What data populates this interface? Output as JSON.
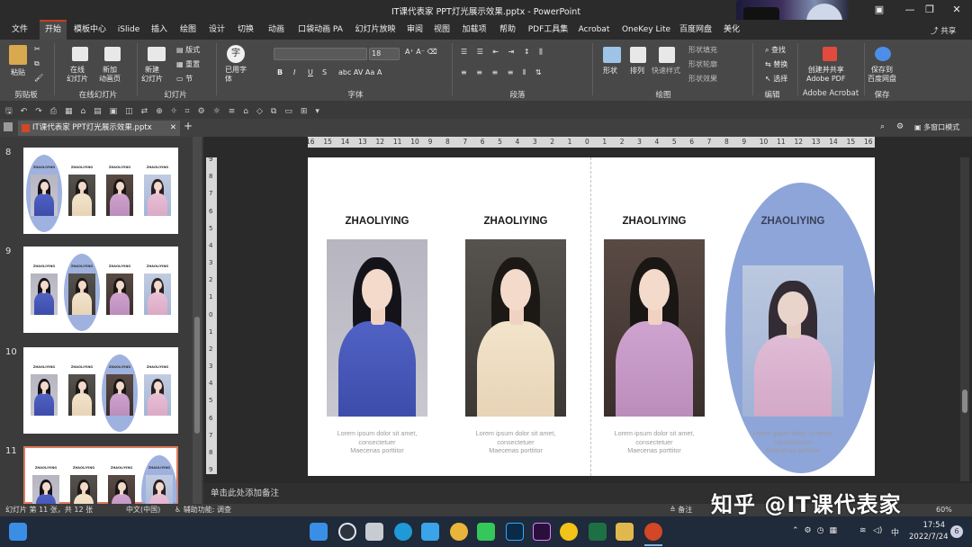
{
  "window": {
    "title": "IT课代表家 PPT灯光展示效果.pptx - PowerPoint",
    "share_label": "共享",
    "minimize_glyph": "—",
    "maximize_glyph": "❐",
    "close_glyph": "✕",
    "restore_glyph": "▣"
  },
  "ribbon_tabs": [
    "文件",
    "开始",
    "模板中心",
    "iSlide",
    "插入",
    "绘图",
    "设计",
    "切换",
    "动画",
    "口袋动画 PA",
    "幻灯片放映",
    "审阅",
    "视图",
    "加载项",
    "帮助",
    "PDF工具集",
    "Acrobat",
    "OneKey Lite",
    "百度网盘",
    "美化"
  ],
  "active_tab": "开始",
  "ribbon": {
    "clipboard": {
      "paste": "粘贴",
      "group": "剪贴板"
    },
    "online_slides": {
      "online": "在线\n幻灯片",
      "new_anim": "新加\n动画页",
      "group": "在线幻灯片"
    },
    "slides": {
      "new_slide": "新建\n幻灯片",
      "layout": "版式",
      "reset": "重置",
      "section": "节",
      "group": "幻灯片"
    },
    "font": {
      "use_font": "已用字\n体",
      "size": "18",
      "group": "字体",
      "b": "B",
      "i": "I",
      "u": "U",
      "s": "S",
      "char_glyph": "字"
    },
    "paragraph": {
      "group": "段落"
    },
    "drawing": {
      "shapes": "形状",
      "arrange": "排列",
      "quick_styles": "快速样式",
      "fill": "形状填充",
      "outline": "形状轮廓",
      "effect": "形状效果",
      "group": "绘图"
    },
    "editing": {
      "find": "查找",
      "replace": "替换",
      "select": "选择",
      "group": "编辑"
    },
    "acrobat": {
      "create": "创建并共享\nAdobe PDF",
      "group": "Adobe Acrobat"
    },
    "save": {
      "save_baidu": "保存到\n百度网盘",
      "group": "保存"
    }
  },
  "file_tab": {
    "name": "IT课代表家 PPT灯光展示效果.pptx",
    "close": "✕",
    "add": "+",
    "multi_window": "多窗口模式"
  },
  "thumbnails": [
    {
      "number": "8",
      "highlight": 0
    },
    {
      "number": "9",
      "highlight": 1
    },
    {
      "number": "10",
      "highlight": 2
    },
    {
      "number": "11",
      "highlight": 3
    }
  ],
  "slide": {
    "columns": [
      {
        "title": "ZHAOLIYING",
        "caption": "Lorem ipsum dolor sit amet,\nconsectetuer\nMaecenas porttitor",
        "photo": "blue-dress-portrait"
      },
      {
        "title": "ZHAOLIYING",
        "caption": "Lorem ipsum dolor sit amet,\nconsectetuer\nMaecenas porttitor",
        "photo": "cream-gown-portrait"
      },
      {
        "title": "ZHAOLIYING",
        "caption": "Lorem ipsum dolor sit amet,\nconsectetuer\nMaecenas porttitor",
        "photo": "lavender-shirt-portrait"
      },
      {
        "title": "ZHAOLIYING",
        "caption": "Lorem ipsum dolor sit amet,\nconsectetuer\nMaecenas porttitor",
        "photo": "pink-dress-portrait"
      }
    ],
    "highlight_color": "#8ea5d9"
  },
  "ruler": {
    "h_ticks": [
      "16",
      "15",
      "14",
      "13",
      "12",
      "11",
      "10",
      "9",
      "8",
      "7",
      "6",
      "5",
      "4",
      "3",
      "2",
      "1",
      "0",
      "1",
      "2",
      "3",
      "4",
      "5",
      "6",
      "7",
      "8",
      "9",
      "10",
      "11",
      "12",
      "13",
      "14",
      "15",
      "16"
    ],
    "v_ticks": [
      "9",
      "8",
      "7",
      "6",
      "5",
      "4",
      "3",
      "2",
      "1",
      "0",
      "1",
      "2",
      "3",
      "4",
      "5",
      "6",
      "7",
      "8",
      "9"
    ]
  },
  "notes_placeholder": "单击此处添加备注",
  "status": {
    "slide_info": "幻灯片 第 11 张，共 12 张",
    "language": "中文(中国)",
    "accessibility": "辅助功能: 调查",
    "notes_btn": "备注",
    "zoom": "60%"
  },
  "watermark": "知乎 @IT课代表家",
  "taskbar": {
    "time": "17:54",
    "date": "2022/7/24",
    "lang": "中",
    "badge": "6"
  },
  "colors": {
    "accent": "#c43e1c",
    "oval": "#8ea5d9"
  }
}
